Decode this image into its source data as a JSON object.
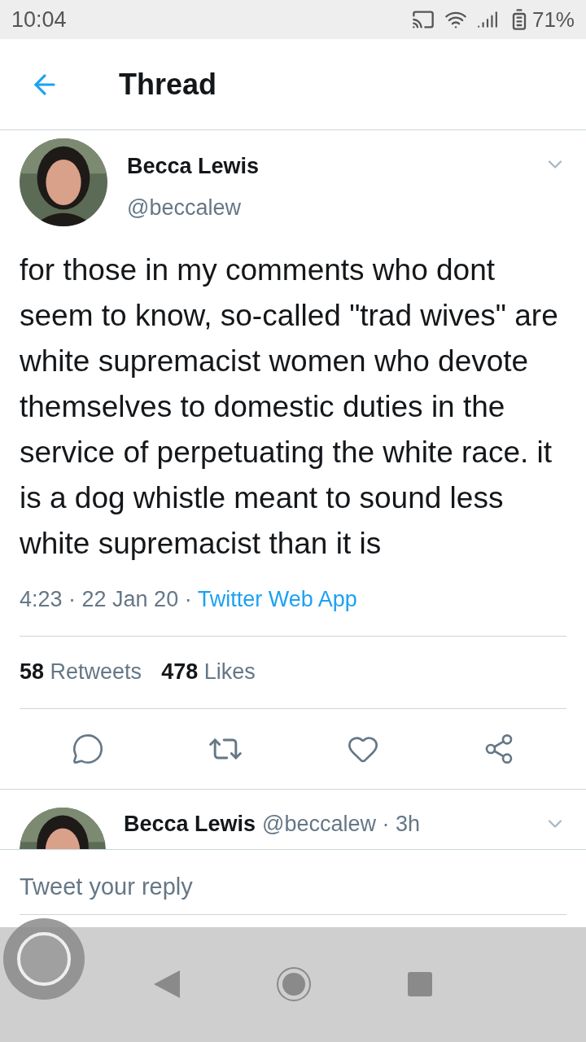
{
  "status_bar": {
    "time": "10:04",
    "battery": "71%"
  },
  "header": {
    "title": "Thread"
  },
  "tweet": {
    "name": "Becca Lewis",
    "handle": "@beccalew",
    "text": "for those in my comments who dont seem to know, so-called \"trad wives\" are white supremacist women who devote themselves to domestic duties in the service of perpetuating the white race. it is a dog whistle meant to sound less white supremacist than it is",
    "time": "4:23 · 22 Jan 20 · ",
    "source": "Twitter Web App",
    "retweets_count": "58",
    "retweets_label": "Retweets",
    "likes_count": "478",
    "likes_label": "Likes"
  },
  "reply": {
    "name": "Becca Lewis",
    "handle": "@beccalew · 3h"
  },
  "reply_field": {
    "placeholder": "Tweet your reply"
  }
}
